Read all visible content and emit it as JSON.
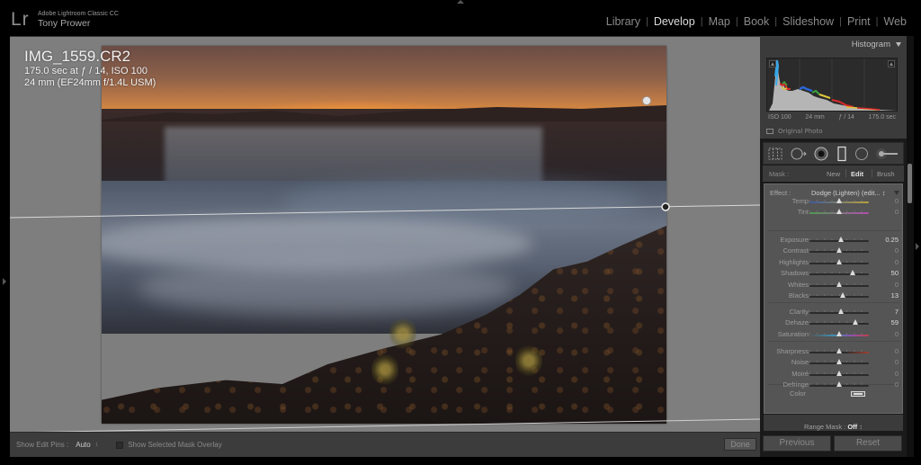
{
  "app": {
    "logo": "Lr",
    "product_name": "Adobe Lightroom Classic CC",
    "user_name": "Tony Prower"
  },
  "modules": [
    {
      "label": "Library",
      "active": false
    },
    {
      "label": "Develop",
      "active": true
    },
    {
      "label": "Map",
      "active": false
    },
    {
      "label": "Book",
      "active": false
    },
    {
      "label": "Slideshow",
      "active": false
    },
    {
      "label": "Print",
      "active": false
    },
    {
      "label": "Web",
      "active": false
    }
  ],
  "photo_info": {
    "filename": "IMG_1559.CR2",
    "exposure_line": "175.0 sec at ƒ / 14, ISO 100",
    "lens_line": "24 mm (EF24mm f/1.4L USM)"
  },
  "toolbar": {
    "show_edit_pins_label": "Show Edit Pins :",
    "show_edit_pins_value": "Auto",
    "stepper_icon": "↕",
    "mask_overlay_label": "Show Selected Mask Overlay",
    "mask_overlay_checked": false,
    "done_label": "Done"
  },
  "histogram": {
    "title": "Histogram",
    "iso": "ISO 100",
    "focal_length": "24 mm",
    "aperture": "ƒ / 14",
    "shutter": "175.0 sec",
    "original_photo_label": "Original Photo"
  },
  "tools": [
    {
      "name": "crop-overlay-icon"
    },
    {
      "name": "spot-removal-icon"
    },
    {
      "name": "red-eye-icon"
    },
    {
      "name": "graduated-filter-icon"
    },
    {
      "name": "radial-filter-icon"
    },
    {
      "name": "adjustment-brush-icon"
    }
  ],
  "mask": {
    "label": "Mask :",
    "new": "New",
    "edit": "Edit",
    "brush": "Brush",
    "active": "Edit"
  },
  "effect": {
    "label": "Effect :",
    "value": "Dodge (Lighten) (edit... ↕"
  },
  "sliders_group1": [
    {
      "label": "Temp",
      "value": "0",
      "pos": 0.5,
      "track": "temp"
    },
    {
      "label": "Tint",
      "value": "0",
      "pos": 0.5,
      "track": "tint"
    }
  ],
  "sliders_group2": [
    {
      "label": "Exposure",
      "value": "0.25",
      "pos": 0.53
    },
    {
      "label": "Contrast",
      "value": "0",
      "pos": 0.5
    },
    {
      "label": "Highlights",
      "value": "0",
      "pos": 0.5
    },
    {
      "label": "Shadows",
      "value": "50",
      "pos": 0.72
    },
    {
      "label": "Whites",
      "value": "0",
      "pos": 0.5
    },
    {
      "label": "Blacks",
      "value": "13",
      "pos": 0.56
    }
  ],
  "sliders_group3": [
    {
      "label": "Clarity",
      "value": "7",
      "pos": 0.53
    },
    {
      "label": "Dehaze",
      "value": "59",
      "pos": 0.77
    },
    {
      "label": "Saturation",
      "value": "0",
      "pos": 0.5,
      "track": "saturation"
    }
  ],
  "sliders_group4": [
    {
      "label": "Sharpness",
      "value": "0",
      "pos": 0.5,
      "track": "sharpness"
    },
    {
      "label": "Noise",
      "value": "0",
      "pos": 0.5
    },
    {
      "label": "Moiré",
      "value": "0",
      "pos": 0.5
    },
    {
      "label": "Defringe",
      "value": "0",
      "pos": 0.5
    }
  ],
  "color": {
    "label": "Color"
  },
  "range_mask": {
    "label": "Range Mask :",
    "value": "Off",
    "stepper": "↕"
  },
  "buttons": {
    "previous": "Previous",
    "reset": "Reset"
  }
}
